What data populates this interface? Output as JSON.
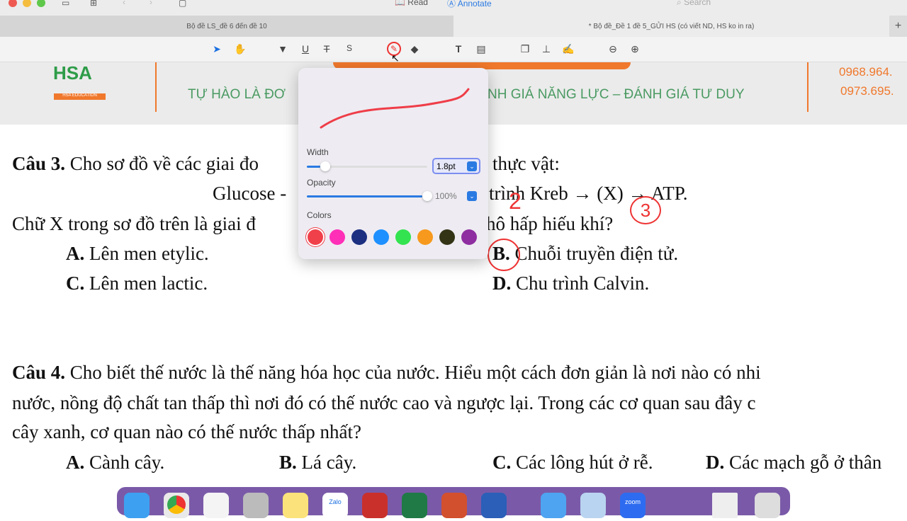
{
  "titlebar": {
    "read": "Read",
    "annotate": "Annotate",
    "search_placeholder": "Search"
  },
  "tabs": [
    {
      "label": "Bộ đề LS_đề 6 đến đề 10"
    },
    {
      "label": "* Bộ đề_Đề 1 đề 5_GỬI HS (có viết ND, HS ko in ra)"
    }
  ],
  "banner": {
    "logo_text": "HSA EDUCATION",
    "slogan_left": "TỰ HÀO LÀ ĐƠ",
    "slogan_right": "NH GIÁ NĂNG LỰC – ĐÁNH GIÁ TƯ DUY",
    "phone1": "0968.964.",
    "phone2": "0973.695."
  },
  "popover": {
    "width_label": "Width",
    "width_value": "1.8pt",
    "width_fraction": 0.05,
    "opacity_label": "Opacity",
    "opacity_value": "100%",
    "opacity_fraction": 1.0,
    "colors_label": "Colors",
    "colors": [
      "#f0404a",
      "#ff2fb8",
      "#1c2f80",
      "#1e90ff",
      "#33e34f",
      "#f7991d",
      "#333316",
      "#8e2ea0"
    ],
    "selected_color": "#f0404a"
  },
  "q3": {
    "label": "Câu 3.",
    "text_a": "Cho sơ đồ về các giai đo",
    "text_b": "thực vật:",
    "glucose": "Glucose -",
    "kreb": "trình Kreb → (X) → ATP.",
    "line3_a": "Chữ X trong sơ đồ trên là giai đ",
    "line3_b": "hô hấp hiếu khí?",
    "options": [
      {
        "key": "A.",
        "text": "Lên men etylic."
      },
      {
        "key": "B.",
        "text": "Chuỗi truyền điện tử."
      },
      {
        "key": "C.",
        "text": "Lên men lactic."
      },
      {
        "key": "D.",
        "text": "Chu trình Calvin."
      }
    ],
    "annotations": [
      "2",
      "3"
    ]
  },
  "q4": {
    "label": "Câu 4.",
    "line1": "Cho biết thế nước là thế năng hóa học của nước. Hiểu một cách đơn giản là nơi nào có nhi",
    "line2": "nước, nồng độ chất tan thấp thì nơi đó có thế nước cao và ngược lại. Trong các cơ quan sau đây c",
    "line3": "cây xanh, cơ quan nào có thế nước thấp nhất?",
    "options": [
      {
        "key": "A.",
        "text": "Cành cây."
      },
      {
        "key": "B.",
        "text": "Lá cây."
      },
      {
        "key": "C.",
        "text": "Các lông hút ở rễ."
      },
      {
        "key": "D.",
        "text": "Các mạch gỗ ở thân"
      }
    ]
  },
  "dock": {
    "zalo": "Zalo",
    "zoom": "zoom"
  }
}
